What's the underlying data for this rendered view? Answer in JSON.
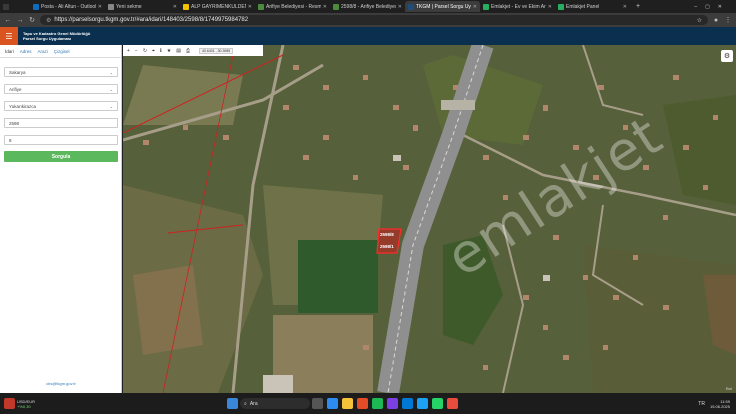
{
  "browser": {
    "tabs": [
      {
        "label": "Posta - Ali Altun - Outlook",
        "color": "#0f6cbd",
        "active": false
      },
      {
        "label": "Yeni sekme",
        "color": "#888888",
        "active": false
      },
      {
        "label": "ALP GAYRIMENKULDEN S",
        "color": "#f2c200",
        "active": false
      },
      {
        "label": "Arifiye Belediyesi - Resmi",
        "color": "#4a8b3c",
        "active": false
      },
      {
        "label": "2598/8 - Arifiye Belediyesi",
        "color": "#4a8b3c",
        "active": false
      },
      {
        "label": "TKGM | Parsel Sorgu Uygu",
        "color": "#1b4e7a",
        "active": true
      },
      {
        "label": "Emlakjet - Ev ve Ekim Ara",
        "color": "#27ae60",
        "active": false
      },
      {
        "label": "Emlakjet Panel",
        "color": "#27ae60",
        "active": false
      }
    ],
    "url": "https://parselsorgu.tkgm.gov.tr/#ara/idari/148403/2598/8/1749975984782"
  },
  "header": {
    "line1": "Tapu ve Kadastro Genel Müdürlüğü",
    "line2": "Parsel Sorgu Uygulaması"
  },
  "sidebar": {
    "tabs": [
      "İdari",
      "Adres",
      "Arazi",
      "Çizgisel"
    ],
    "fields": [
      "Sakarya",
      "Arifiye",
      "Yukarıkirazca",
      "2598",
      "8"
    ],
    "query_label": "Sorgula",
    "footer_email": "cbs@tkgm.gov.tr"
  },
  "map": {
    "coords": "40.6401 , 30.3989",
    "watermark": "emlakjet",
    "parcel_labels": [
      "2598/8",
      "2598/1"
    ],
    "credit": "Esri"
  },
  "taskbar": {
    "currency": "USD/EUR",
    "change": "+%0,30",
    "search": "Ara",
    "lang": "TR",
    "time": "11:59",
    "date": "15.06.2025"
  }
}
